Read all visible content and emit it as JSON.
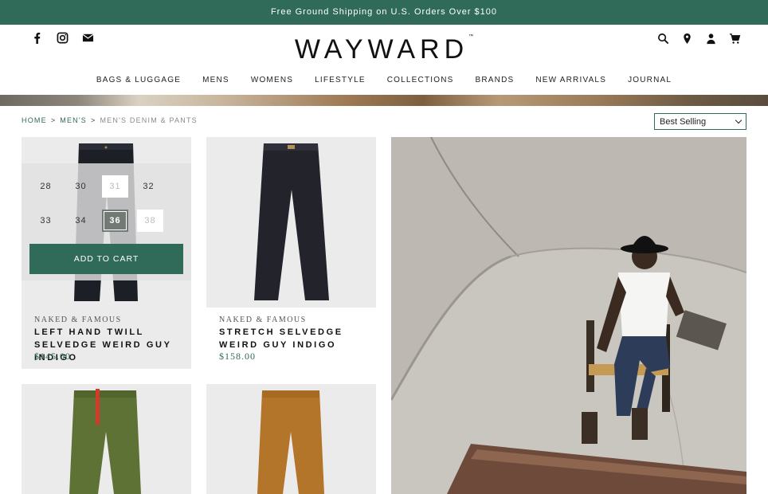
{
  "promo": {
    "text": "Free Ground Shipping on U.S. Orders Over $100"
  },
  "header": {
    "logo": "WAYWARD",
    "logo_tm": "™",
    "social_icons": [
      "facebook-icon",
      "instagram-icon",
      "email-icon"
    ],
    "utility_icons": [
      "search-icon",
      "location-pin-icon",
      "account-icon",
      "cart-icon"
    ]
  },
  "nav": {
    "items": [
      "BAGS & LUGGAGE",
      "MENS",
      "WOMENS",
      "LIFESTYLE",
      "COLLECTIONS",
      "BRANDS",
      "NEW ARRIVALS",
      "JOURNAL"
    ]
  },
  "breadcrumb": {
    "home": "HOME",
    "mens": "MEN'S",
    "separator": ">",
    "current": "MEN'S DENIM & PANTS"
  },
  "sort": {
    "selected": "Best Selling"
  },
  "size_picker": {
    "sizes": [
      {
        "label": "28",
        "state": "available"
      },
      {
        "label": "30",
        "state": "available"
      },
      {
        "label": "31",
        "state": "unavailable"
      },
      {
        "label": "32",
        "state": "available"
      },
      {
        "label": "33",
        "state": "available"
      },
      {
        "label": "34",
        "state": "available"
      },
      {
        "label": "36",
        "state": "selected"
      },
      {
        "label": "38",
        "state": "unavailable"
      }
    ],
    "add_to_cart": "ADD TO CART"
  },
  "products": [
    {
      "brand": "NAKED & FAMOUS",
      "name": "LEFT HAND TWILL SELVEDGE WEIRD GUY INDIGO",
      "price": "$145.00"
    },
    {
      "brand": "NAKED & FAMOUS",
      "name": "STRETCH SELVEDGE WEIRD GUY INDIGO",
      "price": "$158.00"
    }
  ],
  "colors": {
    "brand_green": "#2f6b58",
    "card_bg": "#ebebeb"
  }
}
